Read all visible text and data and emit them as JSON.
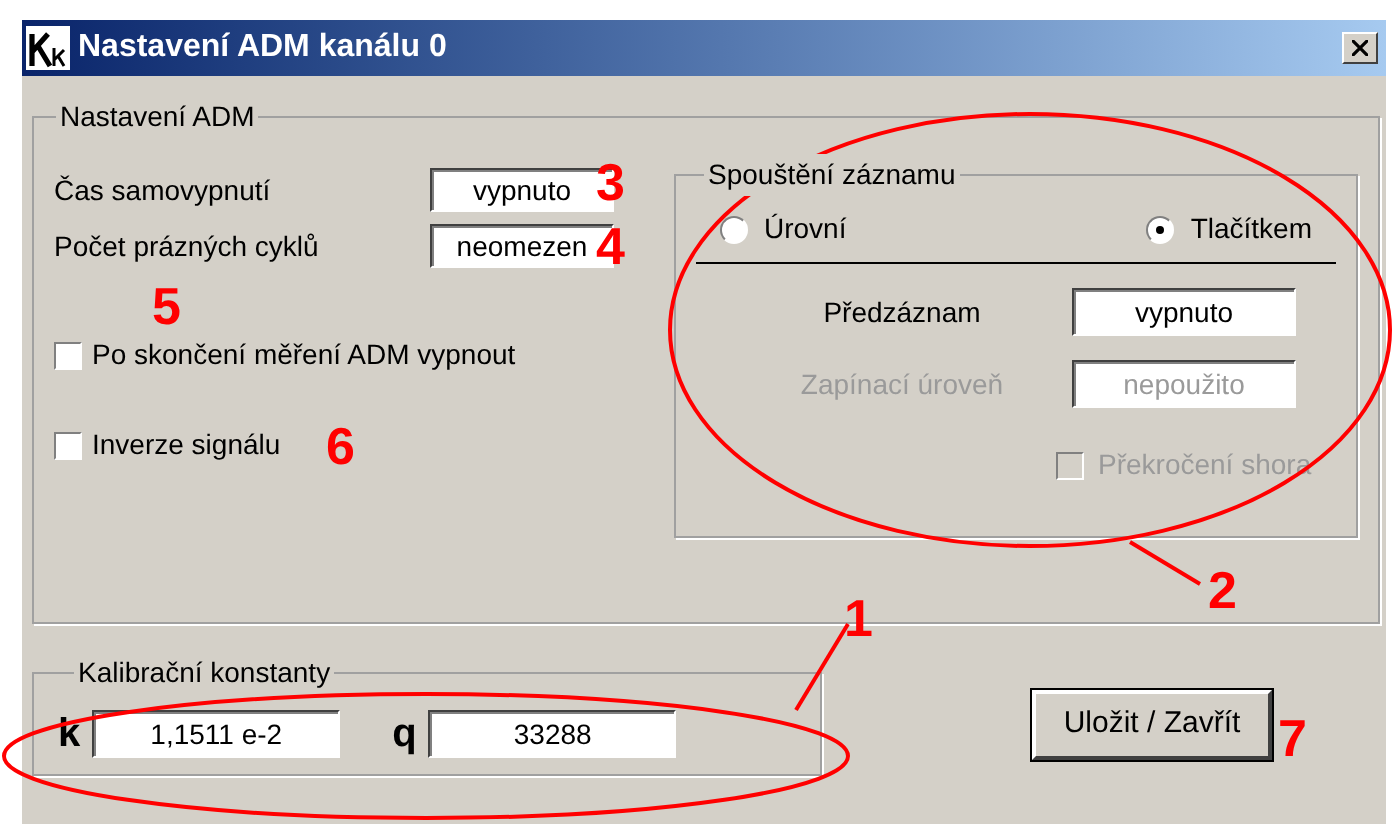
{
  "window": {
    "title": "Nastavení ADM kanálu 0"
  },
  "adm_settings": {
    "title": "Nastavení ADM",
    "fields": [
      {
        "label": "Čas samovypnutí",
        "value": "vypnuto"
      },
      {
        "label": "Počet prázných cyklů",
        "value": "neomezen"
      }
    ],
    "checkboxes": [
      {
        "label": "Po skončení měření ADM vypnout",
        "checked": false
      },
      {
        "label": "Inverze signálu",
        "checked": false
      }
    ]
  },
  "trigger": {
    "title": "Spouštění záznamu",
    "modes": [
      {
        "label": "Úrovní",
        "selected": false
      },
      {
        "label": "Tlačítkem",
        "selected": true
      }
    ],
    "fields": [
      {
        "label": "Předzáznam",
        "value": "vypnuto",
        "disabled": false
      },
      {
        "label": "Zapínací úroveň",
        "value": "nepoužito",
        "disabled": true
      }
    ],
    "checkbox": {
      "label": "Překročení shora",
      "checked": false,
      "disabled": true
    }
  },
  "calibration": {
    "title": "Kalibrační konstanty",
    "constants": [
      {
        "symbol": "k",
        "value": "1,1511 e-2"
      },
      {
        "symbol": "q",
        "value": "33288"
      }
    ]
  },
  "save_button": "Uložit / Zavřít",
  "annotations": [
    {
      "label": "1"
    },
    {
      "label": "2"
    },
    {
      "label": "3"
    },
    {
      "label": "4"
    },
    {
      "label": "5"
    },
    {
      "label": "6"
    },
    {
      "label": "7"
    }
  ]
}
